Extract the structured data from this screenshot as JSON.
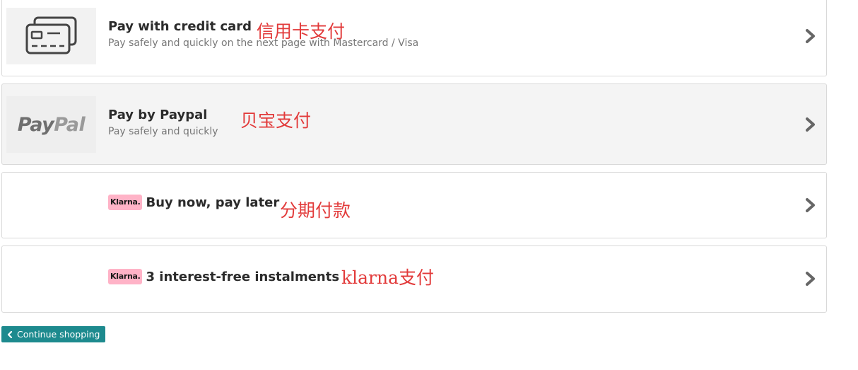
{
  "payment_options": [
    {
      "id": "credit-card",
      "title": "Pay with credit card",
      "subtitle": "Pay safely and quickly on the next page with Mastercard / Visa",
      "annotation": "信用卡支付",
      "icon": "credit-card-icon",
      "selected": false
    },
    {
      "id": "paypal",
      "title": "Pay by Paypal",
      "subtitle": "Pay safely and quickly",
      "annotation": "贝宝支付",
      "logo_text_a": "Pay",
      "logo_text_b": "Pal",
      "selected": true
    },
    {
      "id": "klarna-later",
      "badge": "Klarna.",
      "title": "Buy now, pay later",
      "annotation": "分期付款",
      "selected": false
    },
    {
      "id": "klarna-instalments",
      "badge": "Klarna.",
      "title": "3 interest-free instalments",
      "annotation": "klarna支付",
      "selected": false
    }
  ],
  "continue_button": {
    "label": "Continue shopping",
    "icon": "chevron-left-icon"
  },
  "colors": {
    "accent": "#1d8a8e",
    "annotation": "#e23b3b",
    "klarna_pink": "#ffb3c7",
    "chevron": "#666666"
  }
}
